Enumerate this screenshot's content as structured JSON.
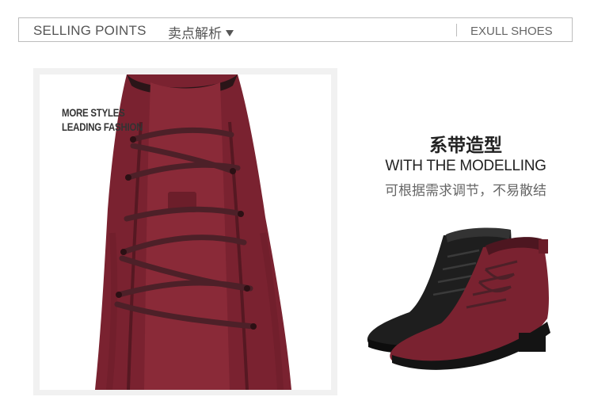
{
  "header": {
    "title_en": "SELLING POINTS",
    "title_cn": "卖点解析",
    "brand": "EXULL SHOES"
  },
  "feature": {
    "tag_line_1": "MORE STYLES",
    "tag_line_2": "LEADING FASHION",
    "title_cn": "系带造型",
    "title_en": "WITH THE MODELLING",
    "subtitle": "可根据需求调节，不易散结"
  },
  "colors": {
    "burgundy": "#7a2230",
    "lace": "#4d2028",
    "black_suede": "#1e1e1e"
  }
}
